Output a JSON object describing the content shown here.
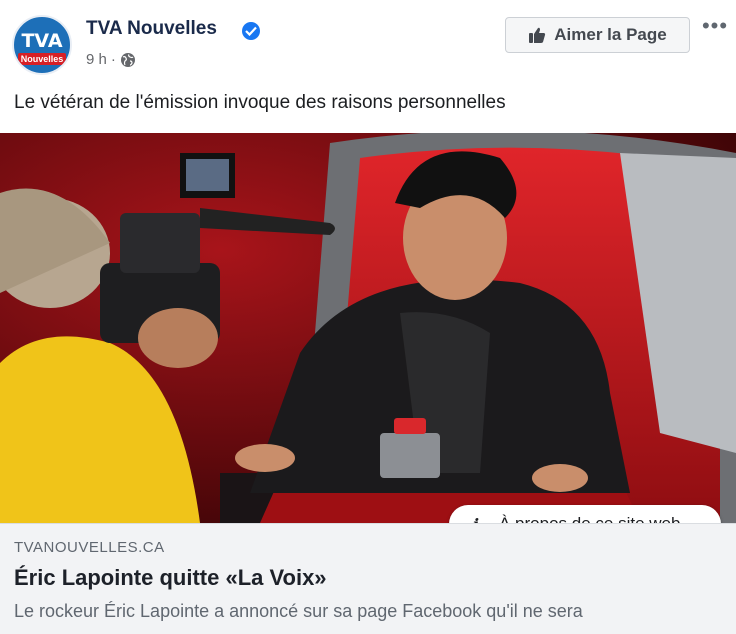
{
  "page": {
    "name": "TVA Nouvelles",
    "logo_main": "TVA",
    "logo_sub": "Nouvelles",
    "time": "9 h",
    "separator": "·",
    "audience_icon": "globe-icon",
    "verified_icon": "verified-badge-icon"
  },
  "actions": {
    "like_page_label": "Aimer la Page",
    "more_label": "•••"
  },
  "post": {
    "text": "Le vétéran de l'émission invoque des raisons personnelles"
  },
  "image_overlay": {
    "about_site_label": "À propos de ce site web"
  },
  "link_preview": {
    "domain": "TVANOUVELLES.CA",
    "title": "Éric Lapointe quitte «La Voix»",
    "description": "Le rockeur Éric Lapointe a annoncé sur sa page Facebook qu'il ne sera"
  },
  "colors": {
    "logo_blue": "#1d6fb8",
    "logo_red": "#d71f26",
    "verified_blue": "#1877f2",
    "chair_red": "#c8171c",
    "preview_bg": "#f2f3f5"
  }
}
